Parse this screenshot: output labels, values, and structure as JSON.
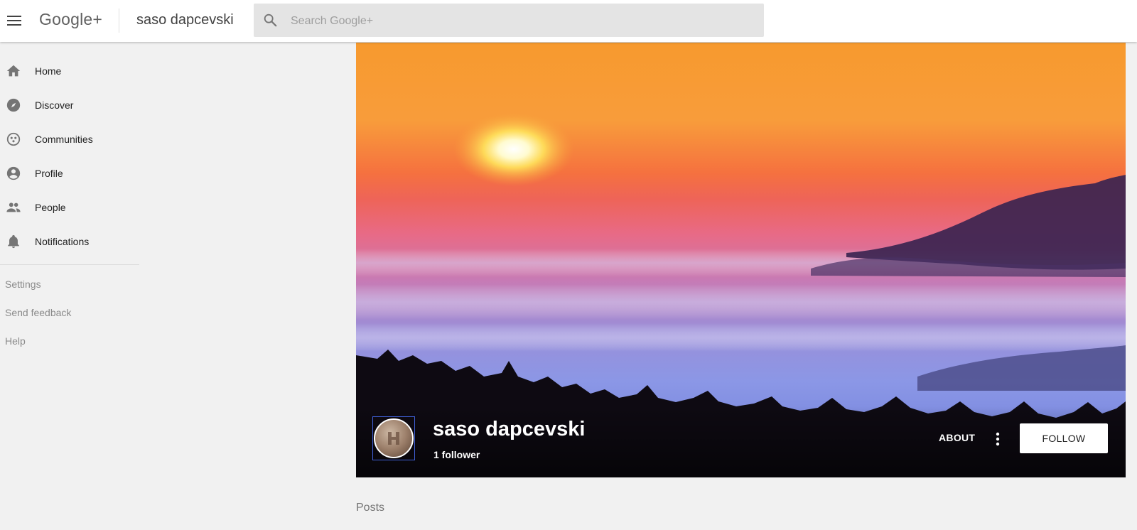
{
  "header": {
    "brand": "Google+",
    "profile_title": "saso dapcevski",
    "search_placeholder": "Search Google+"
  },
  "sidebar": {
    "items": [
      {
        "label": "Home",
        "icon": "home-icon"
      },
      {
        "label": "Discover",
        "icon": "compass-icon"
      },
      {
        "label": "Communities",
        "icon": "communities-icon"
      },
      {
        "label": "Profile",
        "icon": "profile-icon"
      },
      {
        "label": "People",
        "icon": "people-icon"
      },
      {
        "label": "Notifications",
        "icon": "bell-icon"
      }
    ],
    "secondary": [
      "Settings",
      "Send feedback",
      "Help"
    ]
  },
  "profile": {
    "name": "saso dapcevski",
    "followers": "1 follower",
    "about_label": "ABOUT",
    "follow_label": "FOLLOW"
  },
  "content": {
    "section_label": "Posts"
  },
  "colors": {
    "sidebar_bg": "#f1f1f1",
    "topbar_bg": "#ffffff",
    "search_bg": "#e4e4e4",
    "avatar_border": "#3f5fd6"
  }
}
